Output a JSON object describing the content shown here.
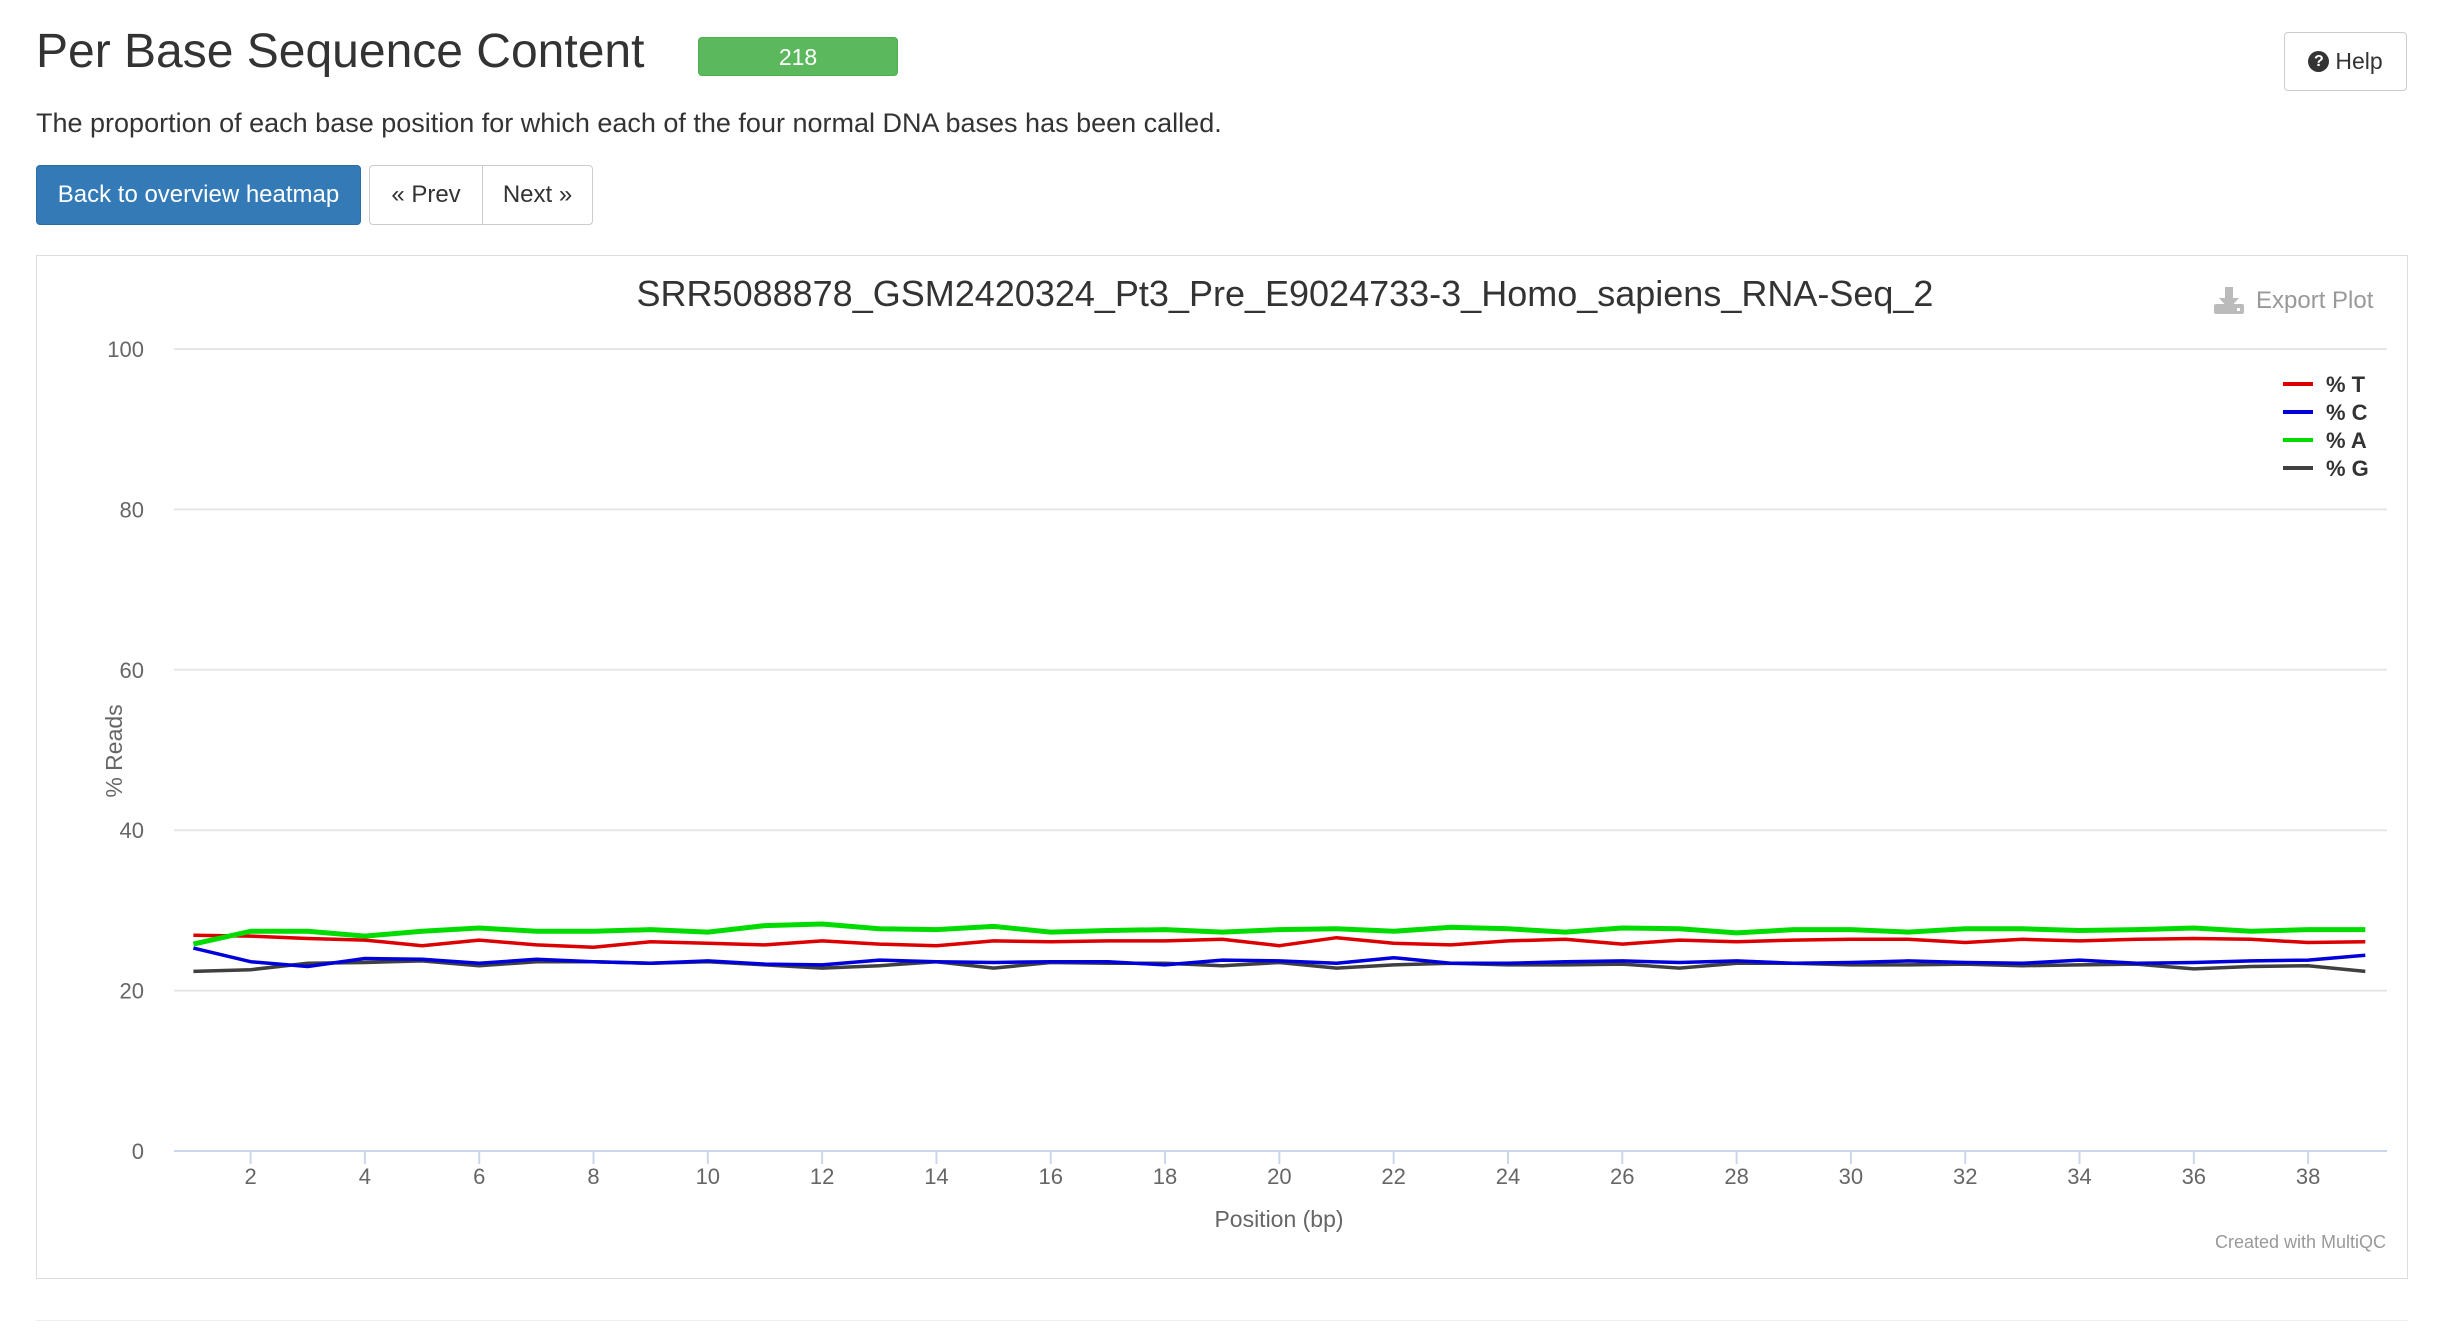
{
  "header": {
    "title": "Per Base Sequence Content",
    "badge": "218",
    "help_label": "Help",
    "description": "The proportion of each base position for which each of the four normal DNA bases has been called."
  },
  "nav": {
    "back_label": "Back to overview heatmap",
    "prev_label": "« Prev",
    "next_label": "Next »"
  },
  "plot": {
    "export_label": "Export Plot",
    "credit": "Created with MultiQC"
  },
  "colors": {
    "T": "#dc0000",
    "C": "#0000dc",
    "A": "#00dc00",
    "G": "#404040",
    "badge": "#5cb85c",
    "primary": "#337ab7"
  },
  "icons": [
    "question-circle-icon",
    "download-icon"
  ],
  "chart_data": {
    "type": "line",
    "title": "SRR5088878_GSM2420324_Pt3_Pre_E9024733-3_Homo_sapiens_RNA-Seq_2",
    "xlabel": "Position (bp)",
    "ylabel": "% Reads",
    "xlim": [
      1,
      39
    ],
    "ylim": [
      0,
      100
    ],
    "xticks": [
      2,
      4,
      6,
      8,
      10,
      12,
      14,
      16,
      18,
      20,
      22,
      24,
      26,
      28,
      30,
      32,
      34,
      36,
      38
    ],
    "yticks": [
      0,
      20,
      40,
      60,
      80,
      100
    ],
    "grid": true,
    "legend_position": "top-right",
    "x": [
      1,
      2,
      3,
      4,
      5,
      6,
      7,
      8,
      9,
      10,
      11,
      12,
      13,
      14,
      15,
      16,
      17,
      18,
      19,
      20,
      21,
      22,
      23,
      24,
      25,
      26,
      27,
      28,
      29,
      30,
      31,
      32,
      33,
      34,
      35,
      36,
      37,
      38,
      39
    ],
    "series": [
      {
        "name": "% T",
        "values": [
          26.9,
          26.8,
          26.5,
          26.3,
          25.6,
          26.3,
          25.7,
          25.4,
          26.1,
          25.9,
          25.7,
          26.2,
          25.8,
          25.6,
          26.2,
          26.1,
          26.2,
          26.2,
          26.4,
          25.6,
          26.6,
          25.9,
          25.7,
          26.2,
          26.4,
          25.8,
          26.3,
          26.1,
          26.3,
          26.4,
          26.4,
          26.0,
          26.4,
          26.2,
          26.4,
          26.5,
          26.4,
          26.0,
          26.1
        ]
      },
      {
        "name": "% C",
        "values": [
          25.3,
          23.6,
          23.0,
          24.0,
          23.9,
          23.4,
          23.9,
          23.6,
          23.4,
          23.7,
          23.3,
          23.2,
          23.8,
          23.6,
          23.5,
          23.6,
          23.6,
          23.2,
          23.8,
          23.7,
          23.4,
          24.1,
          23.4,
          23.4,
          23.6,
          23.7,
          23.5,
          23.7,
          23.4,
          23.5,
          23.7,
          23.5,
          23.4,
          23.8,
          23.4,
          23.5,
          23.7,
          23.8,
          24.4
        ]
      },
      {
        "name": "% A",
        "values": [
          25.8,
          27.4,
          27.4,
          26.8,
          27.4,
          27.8,
          27.4,
          27.4,
          27.6,
          27.3,
          28.1,
          28.3,
          27.7,
          27.6,
          28.0,
          27.3,
          27.5,
          27.6,
          27.3,
          27.6,
          27.7,
          27.4,
          27.9,
          27.7,
          27.3,
          27.8,
          27.7,
          27.2,
          27.6,
          27.6,
          27.3,
          27.7,
          27.7,
          27.5,
          27.6,
          27.8,
          27.4,
          27.6,
          27.6
        ]
      },
      {
        "name": "% G",
        "values": [
          22.4,
          22.6,
          23.4,
          23.5,
          23.7,
          23.1,
          23.6,
          23.6,
          23.4,
          23.6,
          23.2,
          22.8,
          23.1,
          23.6,
          22.8,
          23.5,
          23.4,
          23.4,
          23.1,
          23.5,
          22.8,
          23.2,
          23.4,
          23.2,
          23.2,
          23.3,
          22.8,
          23.4,
          23.4,
          23.2,
          23.2,
          23.3,
          23.1,
          23.2,
          23.3,
          22.7,
          23.0,
          23.1,
          22.4
        ]
      }
    ]
  }
}
